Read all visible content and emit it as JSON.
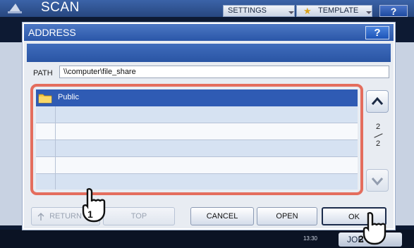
{
  "app": {
    "title": "SCAN"
  },
  "topbar": {
    "settings_label": "SETTINGS",
    "template_label": "TEMPLATE",
    "help_label": "?"
  },
  "dialog": {
    "title": "ADDRESS",
    "help_label": "?",
    "path_label": "PATH",
    "path_value": "\\\\computer\\file_share",
    "list": {
      "rows": [
        {
          "label": "Public",
          "selected": true,
          "icon": "folder-icon"
        },
        {
          "label": "",
          "selected": false
        },
        {
          "label": "",
          "selected": false
        },
        {
          "label": "",
          "selected": false
        },
        {
          "label": "",
          "selected": false
        },
        {
          "label": "",
          "selected": false
        }
      ]
    },
    "page_current": "2",
    "page_total": "2",
    "buttons": {
      "return_label": "RETURN",
      "top_label": "TOP",
      "cancel_label": "CANCEL",
      "open_label": "OPEN",
      "ok_label": "OK"
    }
  },
  "statusbar": {
    "time": "13:30",
    "jobs_label": "JOB"
  },
  "annotations": {
    "step1": "1",
    "step2": "2"
  },
  "colors": {
    "accent": "#2f5bb4",
    "highlight_frame": "#e46d5d"
  }
}
